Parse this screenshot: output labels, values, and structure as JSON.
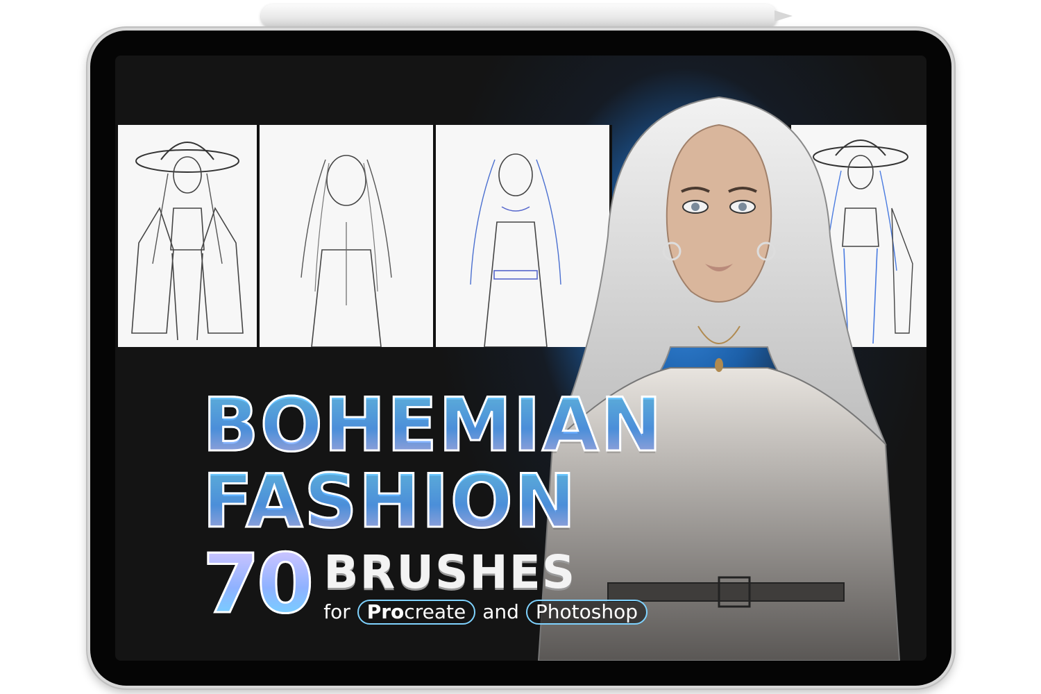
{
  "title": {
    "line1": "BOHEMIAN",
    "line2": "FASHION",
    "count": "70",
    "word": "BRUSHES"
  },
  "apps": {
    "for": "for",
    "procreate_bold": "Pro",
    "procreate_rest": "create",
    "and": "and",
    "photoshop": "Photoshop"
  },
  "colors": {
    "accent_blue": "#59a8ff",
    "accent_cyan": "#6fd0ff",
    "accent_lavender": "#c9c5ff",
    "screen_bg": "#141414",
    "glow": "#3a8fe6"
  }
}
